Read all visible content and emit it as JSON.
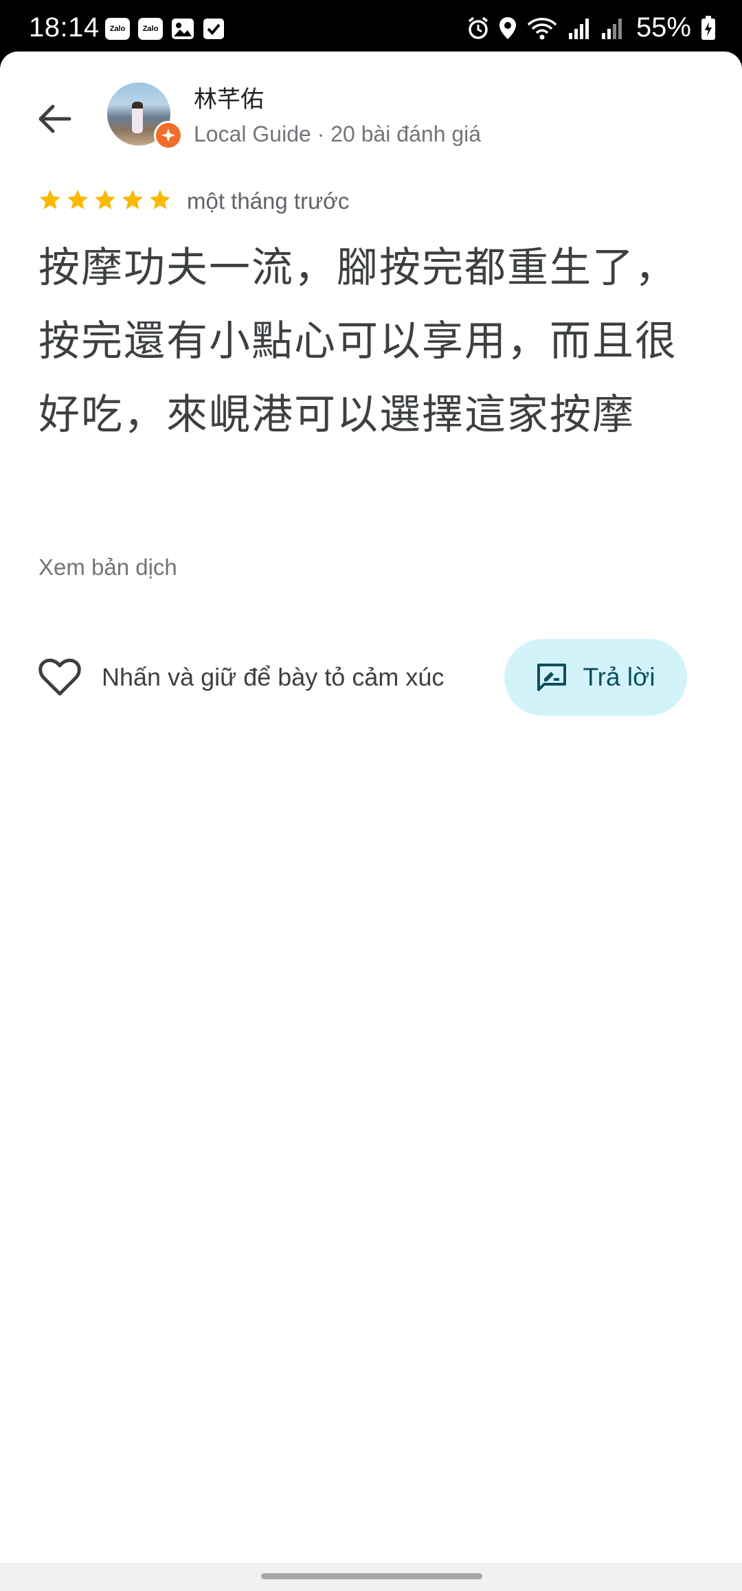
{
  "status_bar": {
    "time": "18:14",
    "notifications": [
      "Zalo",
      "Zalo",
      "gallery-icon",
      "checkbox-icon"
    ],
    "battery_percent": "55%"
  },
  "review": {
    "reviewer_name": "林芊佑",
    "reviewer_sub": "Local Guide · 20 bài đánh giá",
    "rating": 5,
    "time_ago": "một tháng trước",
    "text": "按摩功夫一流，腳按完都重生了，按完還有小點心可以享用，而且很好吃，來峴港可以選擇這家按摩",
    "translate_label": "Xem bản dịch"
  },
  "actions": {
    "react_label": "Nhấn và giữ để bày tỏ cảm xúc",
    "reply_label": "Trả lời"
  },
  "colors": {
    "star": "#f9b900",
    "guide_badge": "#f06d2a",
    "reply_bg": "#d3f3fb",
    "reply_text": "#0b4f60"
  }
}
